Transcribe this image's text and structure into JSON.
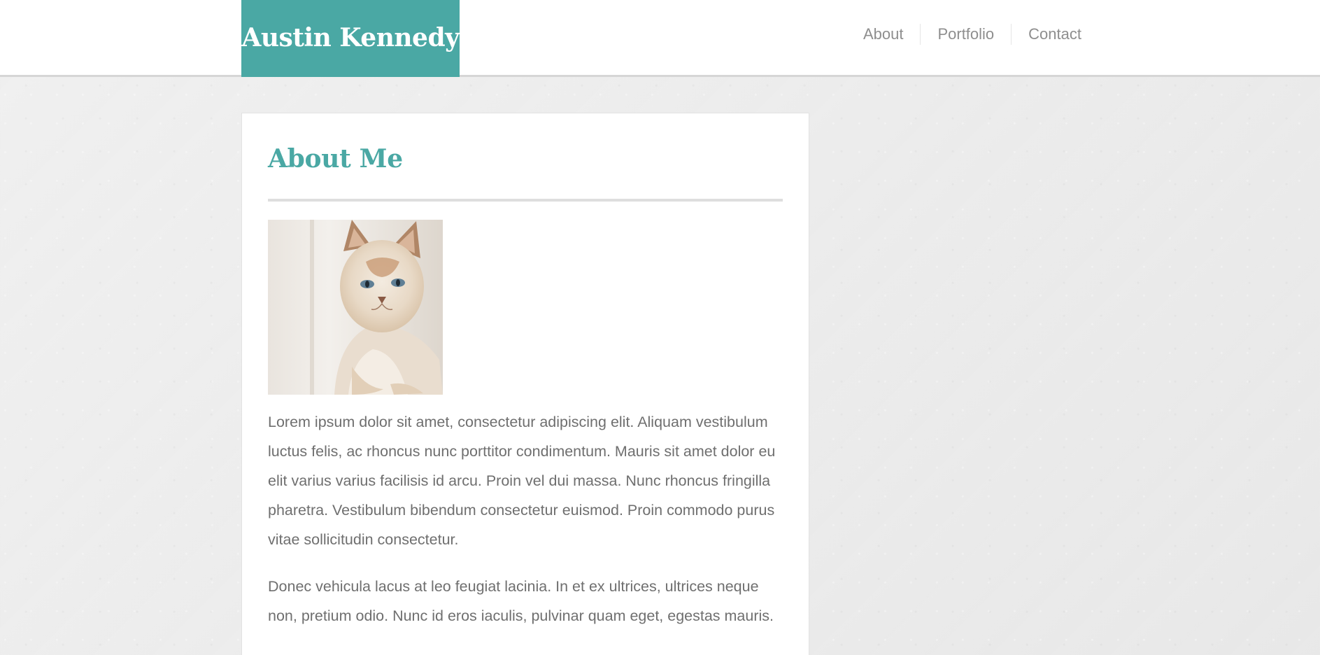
{
  "header": {
    "brand": "Austin Kennedy",
    "nav": [
      {
        "label": "About"
      },
      {
        "label": "Portfolio"
      },
      {
        "label": "Contact"
      }
    ]
  },
  "main": {
    "title": "About Me",
    "image": {
      "alt": "Cat photo",
      "icon": "cat-photo"
    },
    "paragraphs": [
      "Lorem ipsum dolor sit amet, consectetur adipiscing elit. Aliquam vestibulum luctus felis, ac rhoncus nunc porttitor condimentum. Mauris sit amet dolor eu elit varius varius facilisis id arcu. Proin vel dui massa. Nunc rhoncus fringilla pharetra. Vestibulum bibendum consectetur euismod. Proin commodo purus vitae sollicitudin consectetur.",
      "Donec vehicula lacus at leo feugiat lacinia. In et ex ultrices, ultrices neque non, pretium odio. Nunc id eros iaculis, pulvinar quam eget, egestas mauris."
    ]
  },
  "colors": {
    "accent": "#4aa8a4",
    "nav_text": "#8e8e8e",
    "body_text": "#6f6f6f",
    "page_bg": "#ededed"
  }
}
